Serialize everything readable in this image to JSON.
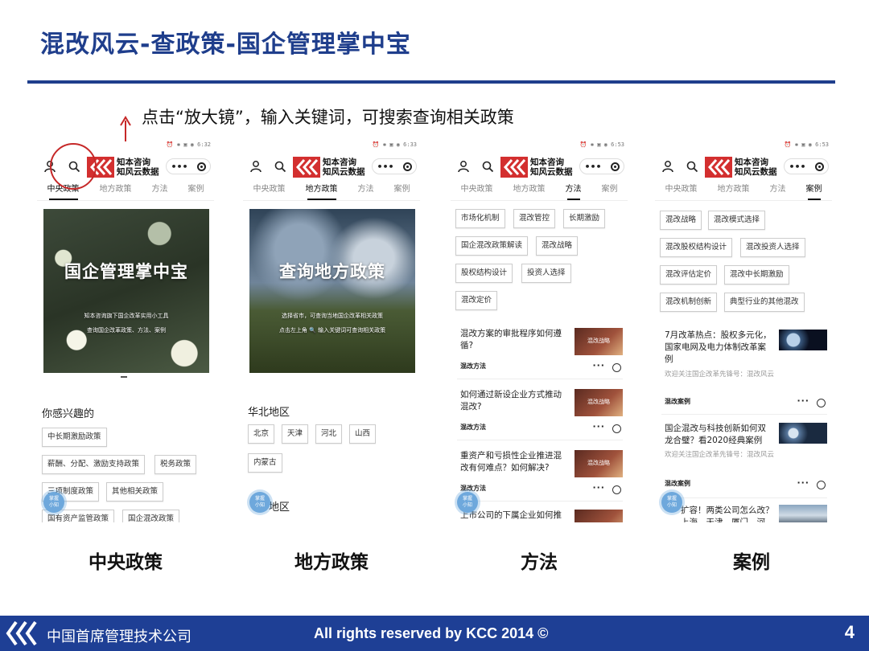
{
  "slide": {
    "title": "混改风云-查政策-国企管理掌中宝",
    "instruction": "点击“放大镜”，输入关键词，可搜索查询相关政策"
  },
  "brand": {
    "line1": "知本咨询",
    "line2": "知风云数据",
    "capsule_dots": "•••"
  },
  "tabs": [
    "中央政策",
    "地方政策",
    "方法",
    "案例"
  ],
  "float_button": {
    "line1": "掌握",
    "line2": "小知"
  },
  "phones": [
    {
      "status": "⏰ ✱ ▣ ◉ 6:32",
      "banner": {
        "title": "国企管理掌中宝",
        "sub1": "知本咨询旗下国企改革实用小工具",
        "sub2": "查询国企改革政策、方法、案例"
      },
      "section": "你感兴趣的",
      "chips": [
        "中长期激励政策",
        "薪酬、分配、激励支持政策",
        "税务政策",
        "三项制度政策",
        "其他相关政策",
        "国有资产监管政策",
        "国企混改政策"
      ]
    },
    {
      "status": "⏰ ✱ ▣ ◉ 6:33",
      "banner": {
        "title": "查询地方政策",
        "sub1": "选择省市，可查询当地国企改革相关政策",
        "sub2": "点击左上角 🔍 输入关键词可查询相关政策"
      },
      "section": "华北地区",
      "chips": [
        "北京",
        "天津",
        "河北",
        "山西",
        "内蒙古"
      ],
      "section2": "地区"
    },
    {
      "status": "⏰ ✱ ▣ ◉ 6:53",
      "chips": [
        "市场化机制",
        "混改管控",
        "长期激励",
        "国企混改政策解读",
        "混改战略",
        "股权结构设计",
        "投资人选择",
        "混改定价"
      ],
      "articles": [
        {
          "title": "混改方案的审批程序如何遵循?",
          "tag": "混改方法",
          "thumb": "混改战略"
        },
        {
          "title": "如何通过新设企业方式推动混改?",
          "tag": "混改方法",
          "thumb": "混改战略"
        },
        {
          "title": "重资产和亏损性企业推进混改有何难点？如何解决?",
          "tag": "混改方法",
          "thumb": "混改战略"
        },
        {
          "title": "上市公司的下属企业如何推",
          "tag": "",
          "thumb": ""
        }
      ]
    },
    {
      "status": "⏰ ✱ ▣ ◉ 6:53",
      "chips": [
        "混改战略",
        "混改模式选择",
        "混改股权结构设计",
        "混改投资人选择",
        "混改评估定价",
        "混改中长期激励",
        "混改机制创新",
        "典型行业的其他混改"
      ],
      "articles": [
        {
          "title": "7月改革热点：股权多元化，国家电网及电力体制改革案例",
          "sub": "欢迎关注国企改革先锋号：混改风云",
          "tag": "混改案例"
        },
        {
          "title": "国企混改与科技创新如何双龙合璧？看2020经典案例",
          "sub": "欢迎关注国企改革先锋号：混改风云",
          "tag": "混改案例"
        },
        {
          "title": "扩容！两类公司怎么改？上海、天津、厦门、河",
          "sub": "",
          "tag": ""
        }
      ]
    }
  ],
  "captions": [
    "中央政策",
    "地方政策",
    "方法",
    "案例"
  ],
  "footer": {
    "company": "中国首席管理技术公司",
    "rights": "All rights reserved by KCC 2014 ©",
    "page": "4"
  },
  "colors": {
    "primary": "#1f3e8c",
    "footer_bg": "#1e3f95",
    "highlight_circle": "#c62828",
    "logo_red": "#d32f2f"
  }
}
